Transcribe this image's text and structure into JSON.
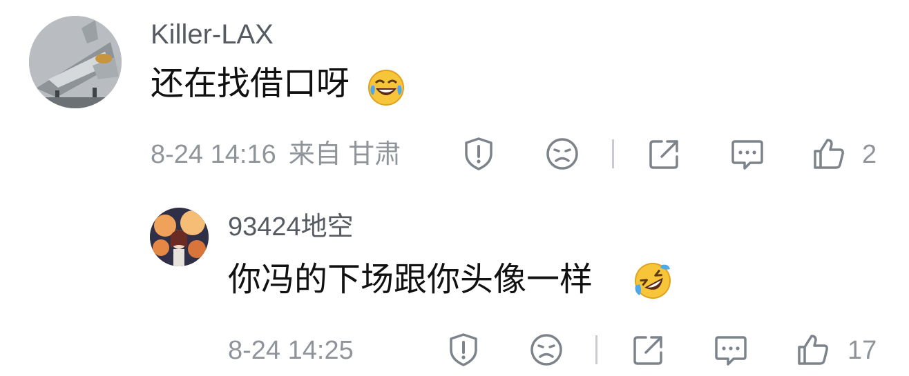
{
  "comments": [
    {
      "username": "Killer-LAX",
      "text": "还在找借口呀",
      "emoji": "laugh-cry-emoji",
      "time": "8-24 14:16",
      "location": "来自 甘肃",
      "likes": "2"
    },
    {
      "username": "93424地空",
      "text": "你冯的下场跟你头像一样",
      "emoji": "rolling-laugh-emoji",
      "time": "8-24 14:25",
      "location": "",
      "likes": "17"
    }
  ],
  "icons": {
    "report": "shield-exclamation-icon",
    "dislike": "sad-face-icon",
    "share": "share-icon",
    "reply": "comment-bubble-icon",
    "like": "thumbs-up-icon"
  },
  "colors": {
    "meta_text": "#8f949a",
    "username": "#555b61",
    "comment_text": "#111111",
    "icon_stroke": "#7d838a",
    "divider": "#c8cbcf"
  }
}
